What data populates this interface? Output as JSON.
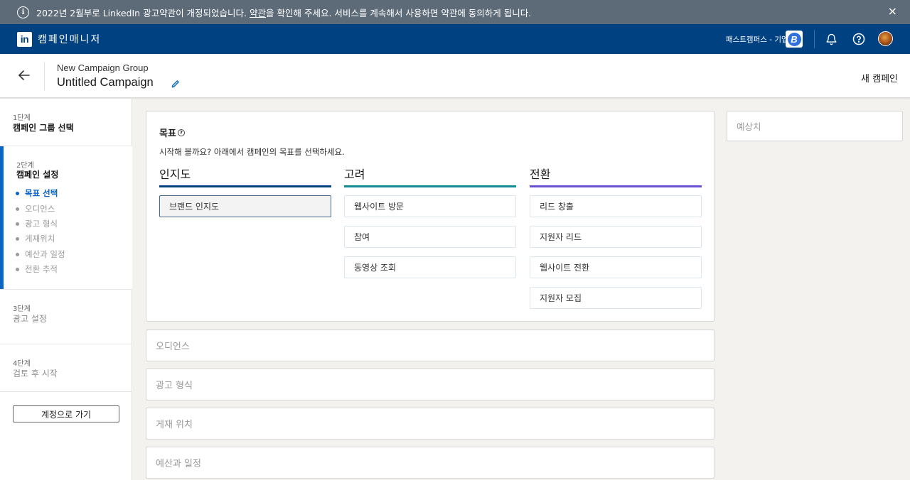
{
  "notice": {
    "text_before": "2022년 2월부로 LinkedIn 광고약관이 개정되었습니다. ",
    "link": "약관",
    "text_after": "을 확인해 주세요. 서비스를 계속해서 사용하면 약관에 동의하게 됩니다.",
    "close": "×"
  },
  "topnav": {
    "logo": "in",
    "app_name": "캠페인매니저",
    "account_name": "패스트캠퍼스 - 기업교육",
    "account_badge": "B"
  },
  "header": {
    "group_name": "New Campaign Group",
    "campaign_name": "Untitled Campaign",
    "new_campaign": "새 캠페인"
  },
  "sidebar": {
    "steps": [
      {
        "num": "1단계",
        "title": "캠페인 그룹 선택"
      },
      {
        "num": "2단계",
        "title": "캠페인 설정",
        "subitems": [
          "목표 선택",
          "오디언스",
          "광고 형식",
          "게재위치",
          "예산과 일정",
          "전환 추적"
        ]
      },
      {
        "num": "3단계",
        "title": "광고 설정"
      },
      {
        "num": "4단계",
        "title": "검토 후 시작"
      }
    ],
    "account_button": "계정으로 가기"
  },
  "objective": {
    "label": "목표",
    "help": "?",
    "intro": "시작해 볼까요? 아래에서 캠페인의 목표를 선택하세요.",
    "columns": [
      {
        "title": "인지도",
        "color": "#004182",
        "options": [
          "브랜드 인지도"
        ]
      },
      {
        "title": "고려",
        "color": "#0e8a94",
        "options": [
          "웹사이트 방문",
          "참여",
          "동영상 조회"
        ]
      },
      {
        "title": "전환",
        "color": "#6a4fd6",
        "options": [
          "리드 창출",
          "지원자 리드",
          "웹사이트 전환",
          "지원자 모집"
        ]
      }
    ],
    "selected": "브랜드 인지도"
  },
  "sections": [
    "오디언스",
    "광고 형식",
    "게재 위치",
    "예산과 일정"
  ],
  "estimate": {
    "label": "예상치"
  }
}
